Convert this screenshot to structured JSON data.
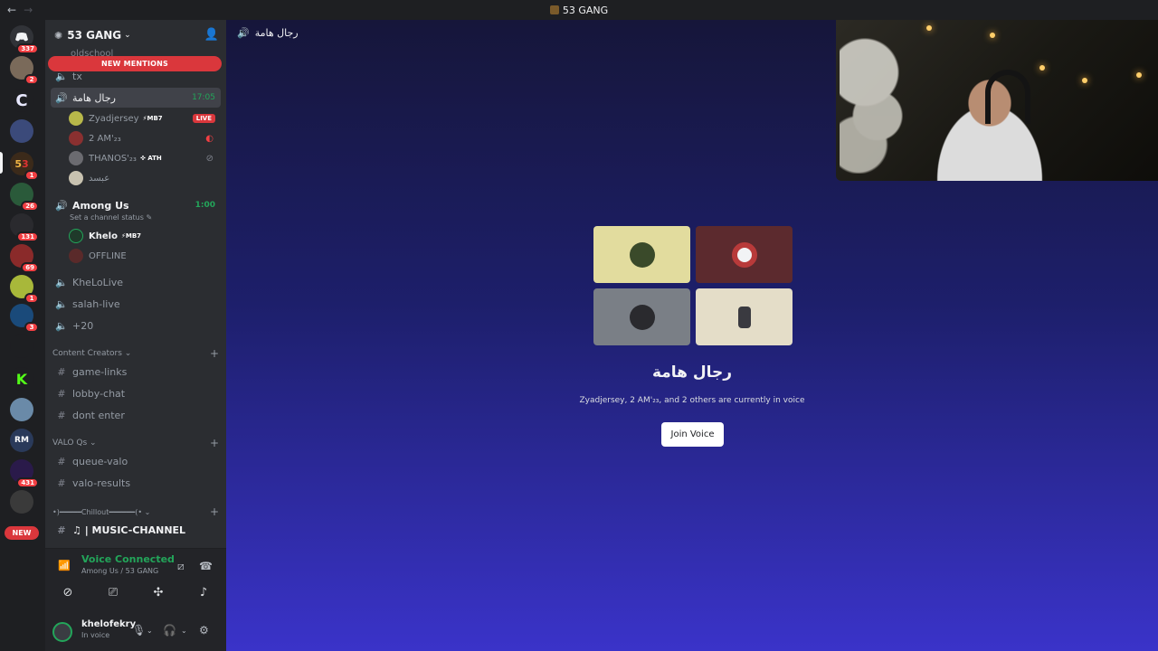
{
  "window": {
    "title": "53 GANG",
    "back": "←",
    "forward": "→"
  },
  "rail": {
    "badges": [
      "337",
      "2",
      "1",
      "26",
      "131",
      "69",
      "1",
      "3",
      "431"
    ],
    "new_label": "NEW"
  },
  "server": {
    "name": "53 GANG",
    "chevron": "⌄"
  },
  "banner": {
    "new_mentions": "NEW MENTIONS",
    "ghost_channel": "oldschool"
  },
  "channels": {
    "tx": "tx",
    "rijal": {
      "name": "رجال هامة",
      "time": "17:05"
    },
    "rijal_users": [
      {
        "name": "Zyadjersey",
        "tag": "⚡MB7",
        "live": "LIVE",
        "color": "#b8b84a"
      },
      {
        "name": "2 AM'₂₃",
        "state": "🎧",
        "color": "#8a3030"
      },
      {
        "name": "THANOS'₂₃",
        "tag": "✜ ATH",
        "state": "⛒",
        "color": "#6b6b70"
      },
      {
        "name": "عبسد",
        "color": "#c8c2b0"
      }
    ],
    "among": {
      "name": "Among Us",
      "time": "1:00",
      "status": "Set a channel status ✎"
    },
    "among_users": [
      {
        "name": "Khelo",
        "tag": "⚡MB7",
        "color": "#1f3a2a"
      },
      {
        "name": "OFFLINE",
        "color": "#5a2a2a"
      }
    ],
    "khelolive": "KheLoLive",
    "salah": "salah-live",
    "plus20": "+20",
    "cat_creators": "Content Creators ⌄",
    "game_links": "game-links",
    "lobby_chat": "lobby-chat",
    "dont_enter": "dont enter",
    "cat_valo": "VALO Qs ⌄",
    "queue_valo": "queue-valo",
    "valo_results": "valo-results",
    "cat_chillout": "•)━━━━━Chillout━━━━━━(• ⌄",
    "music": "♫ | MUSIC-CHANNEL",
    "plus": "+"
  },
  "voice_panel": {
    "status": "Voice Connected",
    "location": "Among Us / 53 GANG"
  },
  "user": {
    "name": "khelofekry",
    "status": "In voice"
  },
  "main": {
    "header": "رجال هامة",
    "voice_title": "رجال هامة",
    "voice_subtitle": "Zyadjersey, 2 AM'₂₃, and 2 others are currently in voice",
    "join_label": "Join Voice",
    "tile_colors": [
      "#e2dc9e",
      "#5c2a2e",
      "#7a7f86",
      "#e4ddc8"
    ]
  }
}
